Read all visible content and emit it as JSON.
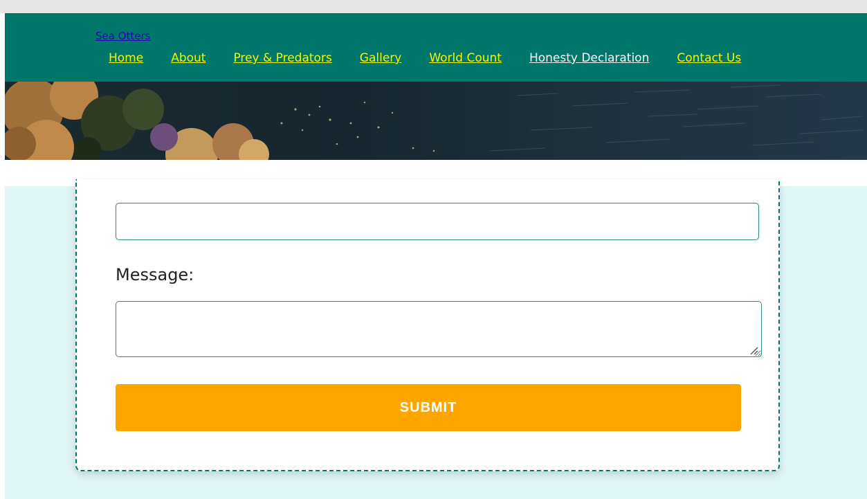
{
  "header": {
    "site_title": "Sea Otters",
    "nav": [
      {
        "label": "Home"
      },
      {
        "label": "About"
      },
      {
        "label": "Prey & Predators"
      },
      {
        "label": "Gallery"
      },
      {
        "label": "World Count"
      },
      {
        "label": "Honesty Declaration"
      },
      {
        "label": "Contact Us"
      }
    ],
    "colors": {
      "header_bg": "#01766a",
      "nav_link": "#f3f700",
      "nav_link_visited": "#ffffff"
    }
  },
  "form": {
    "email_value": "",
    "message_label": "Message:",
    "message_value": "",
    "submit_label": "SUBMIT",
    "colors": {
      "border": "#01766a",
      "submit_bg": "#fea500",
      "content_bg": "#dff5f6"
    }
  }
}
